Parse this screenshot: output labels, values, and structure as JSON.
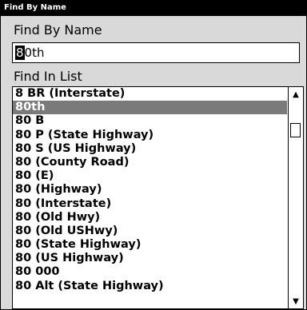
{
  "window": {
    "title": "Find By Name"
  },
  "find_by_name": {
    "label": "Find By Name",
    "input_cursor_char": "8",
    "input_rest": "0th"
  },
  "find_in_list": {
    "label": "Find In List",
    "items": [
      "8 BR (Interstate)",
      "80th",
      "80  B",
      "80  P (State Highway)",
      "80  S (US Highway)",
      "80 (County Road)",
      "80 (E)",
      "80 (Highway)",
      "80 (Interstate)",
      "80 (Old Hwy)",
      "80 (Old USHwy)",
      "80 (State Highway)",
      "80 (US Highway)",
      "80 000",
      "80 Alt (State Highway)"
    ],
    "selected_index": 1
  },
  "scrollbar": {
    "up_icon": "up-arrow-icon",
    "down_icon": "down-arrow-icon"
  }
}
